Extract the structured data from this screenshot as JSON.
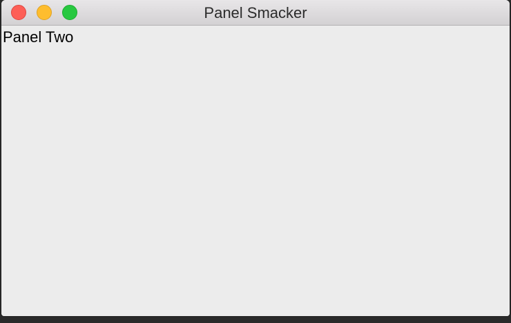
{
  "window": {
    "title": "Panel Smacker",
    "controls": {
      "close_icon": "close-icon",
      "minimize_icon": "minimize-icon",
      "zoom_icon": "zoom-icon",
      "close_color": "#fd5f57",
      "minimize_color": "#febd2e",
      "zoom_color": "#28c840"
    }
  },
  "content": {
    "panel_label": "Panel Two"
  }
}
